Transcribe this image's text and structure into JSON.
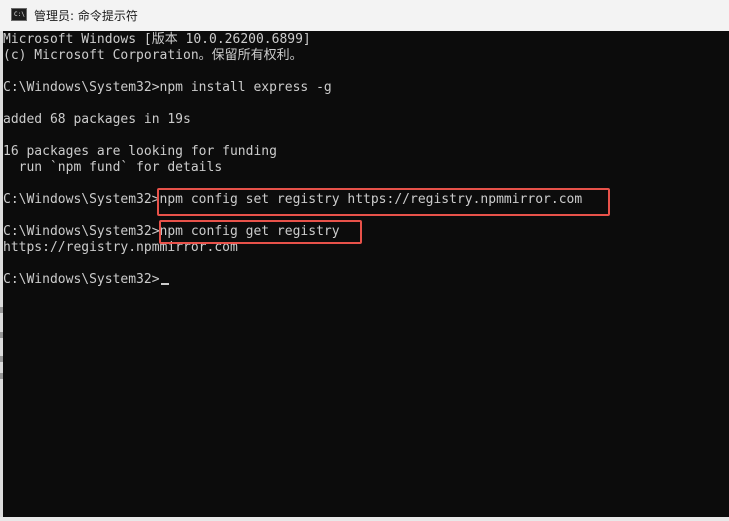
{
  "window": {
    "title": "管理员: 命令提示符",
    "icon": "cmd-icon",
    "icon_glyph": "C:\\"
  },
  "console": {
    "background": "#0c0c0c",
    "foreground": "#cccccc",
    "lines": [
      "Microsoft Windows [版本 10.0.26200.6899]",
      "(c) Microsoft Corporation。保留所有权利。",
      "",
      "C:\\Windows\\System32>npm install express -g",
      "",
      "added 68 packages in 19s",
      "",
      "16 packages are looking for funding",
      "  run `npm fund` for details",
      "",
      "C:\\Windows\\System32>npm config set registry https://registry.npmmirror.com",
      "",
      "C:\\Windows\\System32>npm config get registry",
      "https://registry.npmmirror.com",
      "",
      "C:\\Windows\\System32>"
    ],
    "cursor": "underscore"
  },
  "annotations": {
    "highlight_color": "#e8524a",
    "highlighted_commands": [
      "npm config set registry https://registry.npmmirror.com",
      "npm config get registry"
    ]
  }
}
